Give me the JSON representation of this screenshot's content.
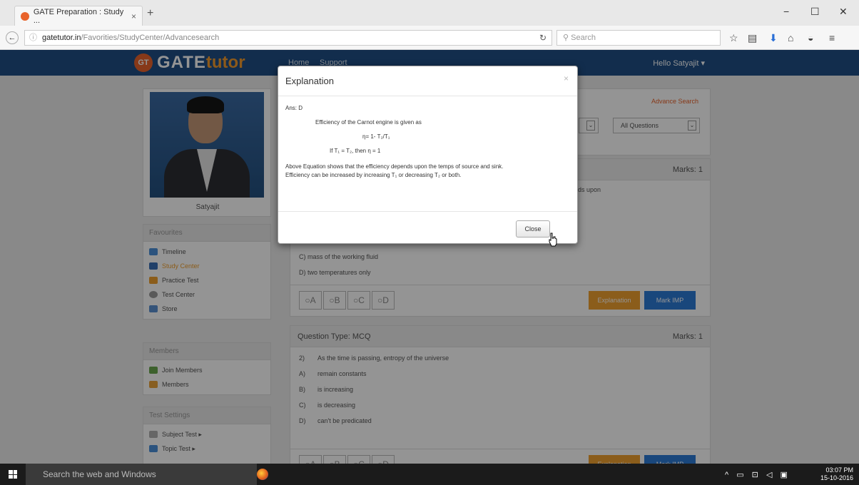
{
  "browser": {
    "tab_title": "GATE Preparation : Study ...",
    "tab_close": "×",
    "new_tab": "+",
    "url_host": "gatetutor.in",
    "url_path": "/Favorities/StudyCenter/Advancesearch",
    "search_placeholder": "Search",
    "window_controls": [
      "−",
      "☐",
      "✕"
    ]
  },
  "site": {
    "logo_gt": "GT",
    "logo_gate": "GATE",
    "logo_tutor": "tutor",
    "nav": [
      "Home",
      "Support"
    ],
    "greeting": "Hello Satyajit ▾"
  },
  "profile": {
    "name": "Satyajit"
  },
  "sidebar": {
    "favourites": {
      "heading": "Favourites",
      "items": [
        {
          "label": "Timeline",
          "color": "#4a90d9"
        },
        {
          "label": "Study Center",
          "color": "#3a6fb5"
        },
        {
          "label": "Practice Test",
          "color": "#f0a030"
        },
        {
          "label": "Test Center",
          "color": "#999999"
        },
        {
          "label": "Store",
          "color": "#5b8fd0"
        }
      ]
    },
    "members": {
      "heading": "Members",
      "items": [
        {
          "label": "Join Members",
          "color": "#6aa84f"
        },
        {
          "label": "Members",
          "color": "#e8a33a"
        }
      ]
    },
    "test_settings": {
      "heading": "Test Settings",
      "items": [
        {
          "label": "Subject Test ▸",
          "color": "#b0b0b0"
        },
        {
          "label": "Topic Test ▸",
          "color": "#4a90d9"
        }
      ]
    }
  },
  "filters": {
    "advance_search": "Advance Search",
    "select_questions": "All Questions",
    "chevron": "⌄"
  },
  "question1": {
    "type": "Question Type: MCQ",
    "marks": "Marks: 1",
    "visible_fragment": "nds upon",
    "option_c": "C)   mass of the working fluid",
    "option_d": "D)   two temperatures only"
  },
  "question2": {
    "type": "Question Type: MCQ",
    "marks": "Marks: 1",
    "lines": [
      {
        "k": "2)",
        "v": "As the time is passing, entropy of the universe"
      },
      {
        "k": "A)",
        "v": "remain constants"
      },
      {
        "k": "B)",
        "v": "is increasing"
      },
      {
        "k": "C)",
        "v": "is decreasing"
      },
      {
        "k": "D)",
        "v": "can't be predicated"
      }
    ]
  },
  "answer_options": [
    "A",
    "B",
    "C",
    "D"
  ],
  "buttons": {
    "explanation": "Explanation",
    "mark_imp": "Mark IMP"
  },
  "modal": {
    "title": "Explanation",
    "close_x": "×",
    "ans": "Ans: D",
    "line1": "Efficiency of the Carnot engine is given as",
    "formula": "η= 1- T₂/T₁",
    "condition": "If T₁ = T₂, then η = 1",
    "para1": "Above Equation shows that the efficiency depends upon the temps of source and sink.",
    "para2": "Efficiency can be increased by increasing T₁ or decreasing T₂ or both.",
    "close_label": "Close"
  },
  "taskbar": {
    "search_text": "Search the web and Windows",
    "tray": "^ ▭ ⊡ ◁ ▣",
    "time": "03:07 PM",
    "date": "15-10-2016"
  }
}
